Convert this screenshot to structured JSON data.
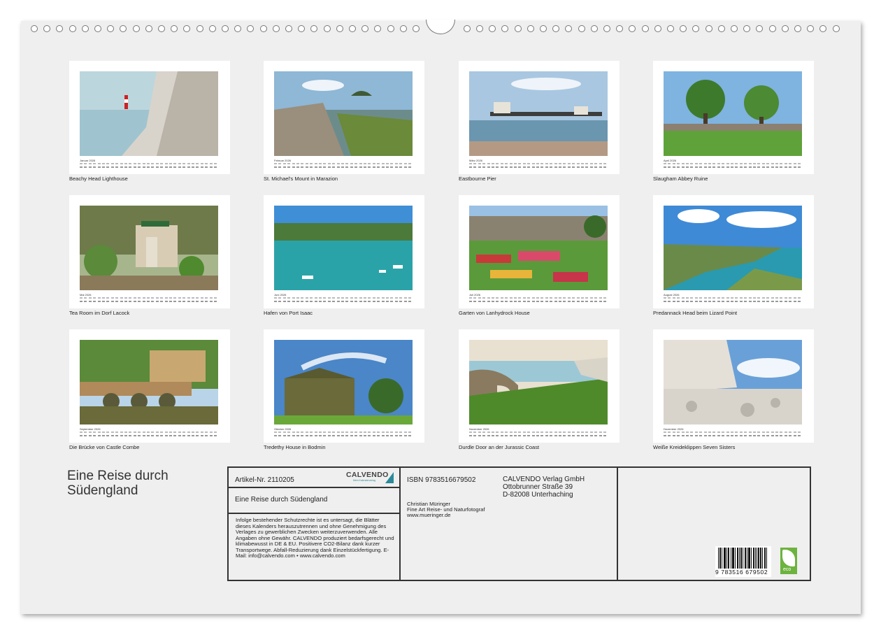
{
  "calendar": {
    "title_line1": "Eine Reise durch",
    "title_line2": "Südengland",
    "months": [
      {
        "label": "Januar 2026",
        "caption": "Beachy Head Lighthouse"
      },
      {
        "label": "Februar 2026",
        "caption": "St. Michael's Mount in Marazion"
      },
      {
        "label": "März 2026",
        "caption": "Eastbourne Pier"
      },
      {
        "label": "April 2026",
        "caption": "Slaugham Abbey Ruine"
      },
      {
        "label": "Mai 2026",
        "caption": "Tea Room im Dorf Lacock"
      },
      {
        "label": "Juni 2026",
        "caption": "Hafen von Port Isaac"
      },
      {
        "label": "Juli 2026",
        "caption": "Garten von Lanhydrock House"
      },
      {
        "label": "August 2026",
        "caption": "Predannack Head beim Lizard Point"
      },
      {
        "label": "September 2026",
        "caption": "Die Brücke von Castle Combe"
      },
      {
        "label": "Oktober 2026",
        "caption": "Tredethy House in Bodmin"
      },
      {
        "label": "November 2026",
        "caption": "Durdle Door an der Jurassic Coast"
      },
      {
        "label": "Dezember 2026",
        "caption": "Weiße Kreideklippen Seven Sisters"
      }
    ]
  },
  "info": {
    "article": "Artikel-Nr. 2110205",
    "logo": "CALVENDO",
    "logo_sub": "Mein Kalenderverlag",
    "product_title": "Eine Reise durch Südengland",
    "legal": "Infolge bestehender Schutzrechte ist es untersagt, die Blätter dieses Kalenders herauszutrennen und ohne Genehmigung des Verlages zu gewerblichen Zwecken weiterzuverwenden. Alle Angaben ohne Gewähr. CALVENDO produziert bedarfsgerecht und klimabewusst in DE & EU. Positivere CO2-Bilanz dank kurzer Transportwege. Abfall-Reduzierung dank Einzelstückfertigung. E-Mail: info@calvendo.com • www.calvendo.com",
    "isbn": "ISBN 9783516679502",
    "publisher_name": "CALVENDO Verlag GmbH",
    "publisher_street": "Ottobrunner Straße 39",
    "publisher_city": "D-82008 Unterhaching",
    "author_name": "Christian Müringer",
    "author_title": "Fine Art Reise- und Naturfotograf",
    "author_web": "www.mueringer.de",
    "barcode_number": "9 783516 679502",
    "eco_label": "eco"
  }
}
